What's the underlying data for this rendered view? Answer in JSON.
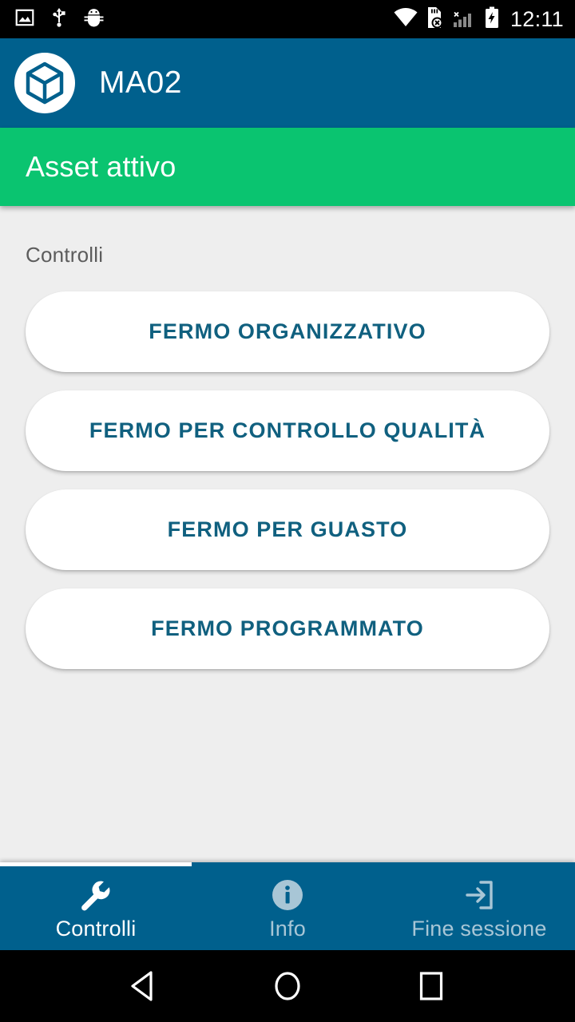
{
  "status_bar": {
    "time": "12:11",
    "left_icons": [
      "screenshot-icon",
      "usb-icon",
      "android-debug-icon"
    ],
    "right_icons": [
      "wifi-icon",
      "sd-card-error-icon",
      "signal-no-service-icon",
      "battery-charging-icon"
    ]
  },
  "app_bar": {
    "logo_icon": "cube-logo-icon",
    "title": "MA02",
    "background_color": "#00608d"
  },
  "status_banner": {
    "text": "Asset attivo",
    "background_color": "#0ac470"
  },
  "content": {
    "section_label": "Controlli",
    "background_color": "#eeeeee",
    "buttons": [
      {
        "label": "FERMO ORGANIZZATIVO",
        "name": "fermo-organizzativo-button"
      },
      {
        "label": "FERMO PER CONTROLLO QUALITÀ",
        "name": "fermo-controllo-qualita-button"
      },
      {
        "label": "FERMO PER GUASTO",
        "name": "fermo-per-guasto-button"
      },
      {
        "label": "FERMO PROGRAMMATO",
        "name": "fermo-programmato-button"
      }
    ],
    "button_text_color": "#10607f"
  },
  "bottom_nav": {
    "active_index": 0,
    "items": [
      {
        "label": "Controlli",
        "icon": "wrench-icon"
      },
      {
        "label": "Info",
        "icon": "info-circle-icon"
      },
      {
        "label": "Fine sessione",
        "icon": "exit-icon"
      }
    ]
  },
  "system_nav": {
    "back": "back-triangle-icon",
    "home": "home-circle-icon",
    "recents": "recents-square-icon"
  }
}
